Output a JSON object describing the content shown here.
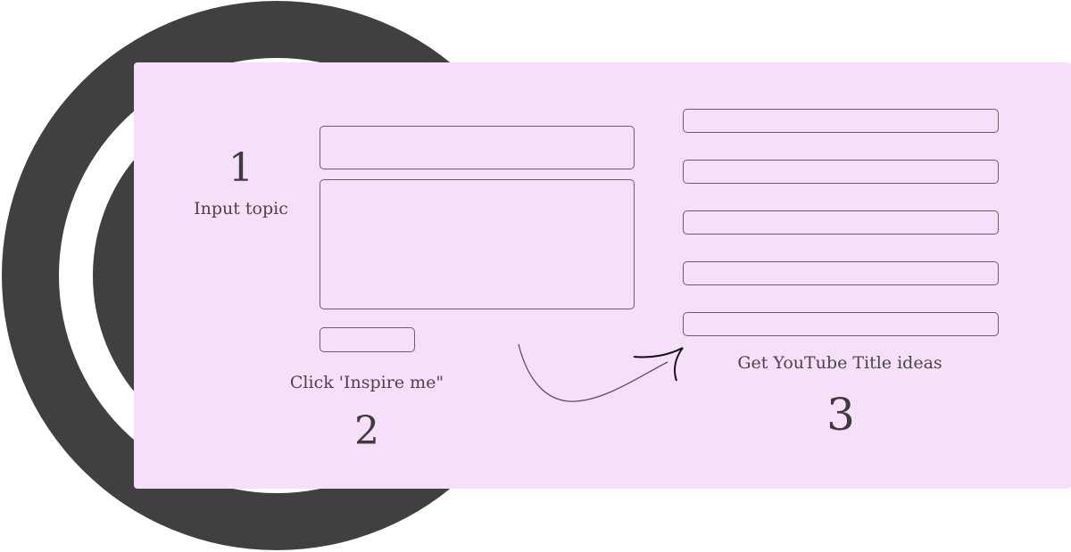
{
  "steps": [
    {
      "number": "1",
      "label": "Input topic"
    },
    {
      "number": "2",
      "label": "Click 'Inspire me\""
    },
    {
      "number": "3",
      "label": "Get YouTube Title ideas"
    }
  ],
  "result_fields_count": 5,
  "colors": {
    "card_background": "#f6dff8",
    "ring_dark": "#414041",
    "text": "#3f3b3d",
    "outline": "#6a5f68"
  }
}
